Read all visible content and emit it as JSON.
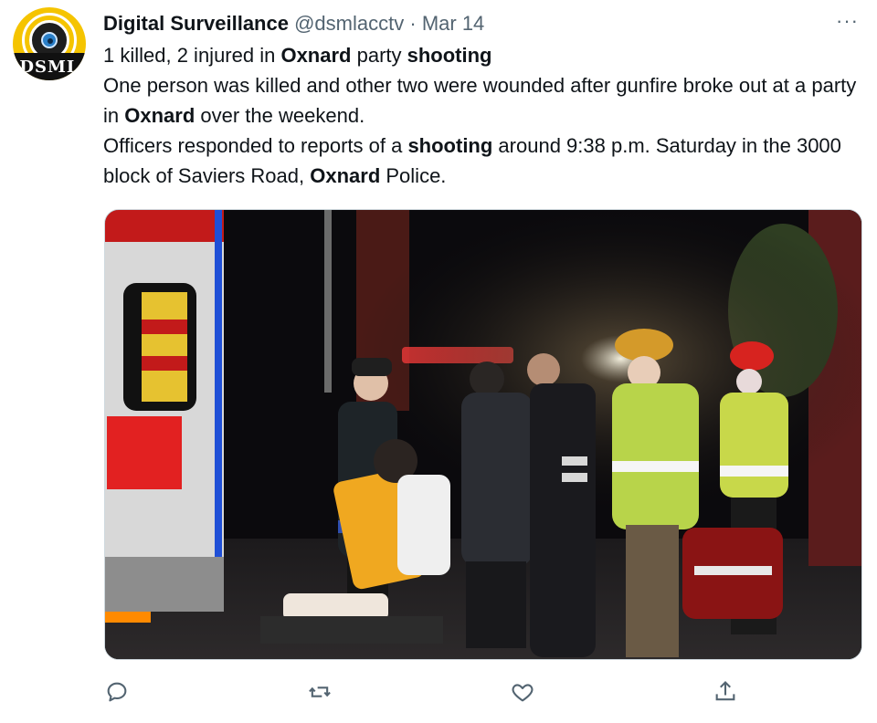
{
  "author": {
    "avatar_text": "DSML",
    "display_name": "Digital Surveillance",
    "handle": "@dsmlacctv",
    "separator": "·",
    "date": "Mar 14"
  },
  "more_label": "···",
  "tweet": {
    "line1": {
      "a": "1 killed, 2 injured in ",
      "b": "Oxnard",
      "c": " party ",
      "d": "shooting"
    },
    "para2": {
      "a": "One person was killed and other two were wounded after gunfire broke out at a party in ",
      "b": "Oxnard",
      "c": " over the weekend."
    },
    "para3": {
      "a": "Officers responded to reports of a ",
      "b": "shooting",
      "c": " around 9:38 p.m. Saturday in the 3000 block of Saviers Road, ",
      "d": "Oxnard",
      "e": " Police."
    }
  },
  "actions": [
    {
      "icon": "reply-icon"
    },
    {
      "icon": "retweet-icon"
    },
    {
      "icon": "like-icon"
    },
    {
      "icon": "share-icon"
    }
  ],
  "colors": {
    "text": "#0f1419",
    "secondary": "#536471",
    "border": "#cfd9de",
    "avatar_yellow": "#f5c400"
  }
}
